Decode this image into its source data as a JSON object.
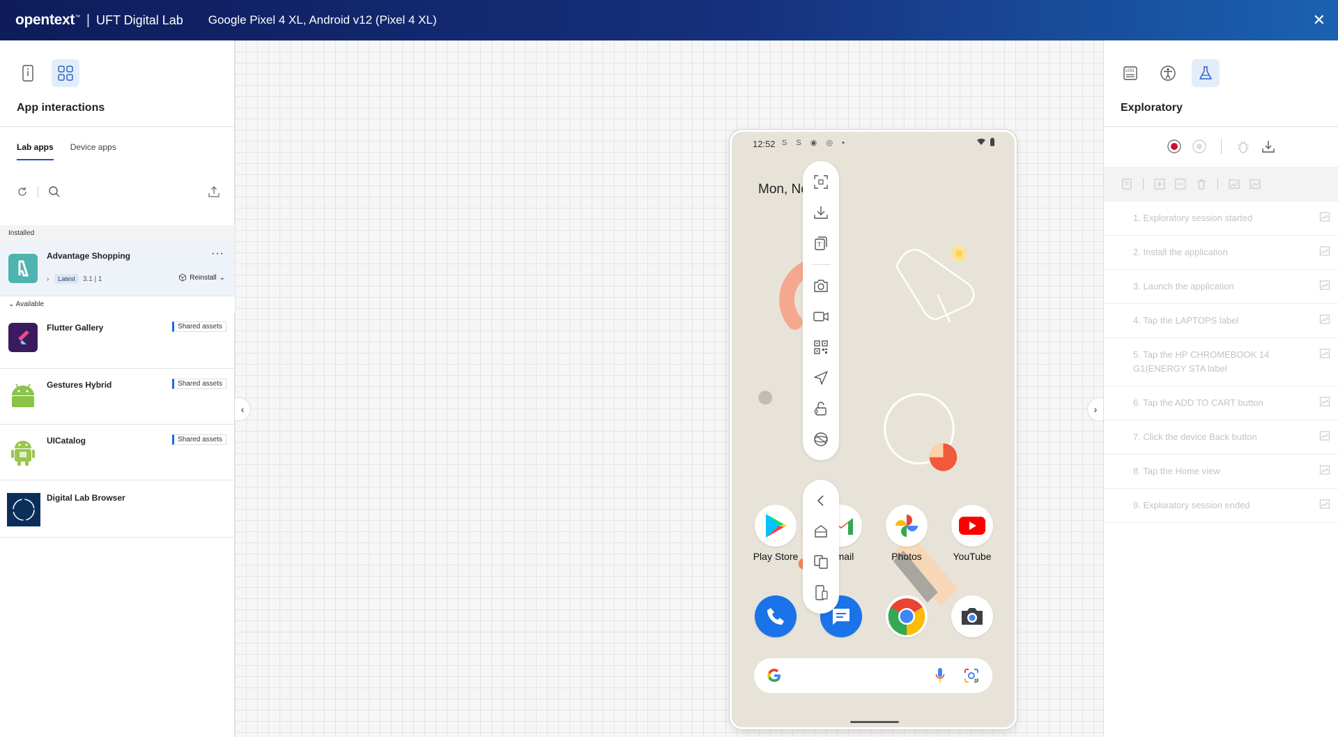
{
  "header": {
    "brand": "opentext",
    "brand_tm": "™",
    "product": "UFT Digital Lab",
    "device": "Google Pixel 4 XL, Android v12 (Pixel 4 XL)",
    "close": "✕"
  },
  "left_panel": {
    "title": "App interactions",
    "tabs": [
      "Lab apps",
      "Device apps"
    ],
    "installed_label": "Installed",
    "available_label": "Available",
    "installed_app": {
      "name": "Advantage Shopping",
      "version_tag": "Latest",
      "version": "3.1 | 1",
      "action": "Reinstall",
      "more": "···"
    },
    "available_apps": [
      {
        "name": "Flutter Gallery",
        "badge": "Shared assets"
      },
      {
        "name": "Gestures Hybrid",
        "badge": "Shared assets"
      },
      {
        "name": "UICatalog",
        "badge": "Shared assets"
      },
      {
        "name": "Digital Lab Browser",
        "badge": ""
      }
    ]
  },
  "phone": {
    "time": "12:52",
    "status_icons": "S S ◉ ◎ •",
    "date": "Mon, Nov 8",
    "apps_row1": [
      "Play Store",
      "Gmail",
      "Photos",
      "YouTube"
    ]
  },
  "right_panel": {
    "title": "Exploratory",
    "steps": [
      "1.  Exploratory session started",
      "2.  Install the application",
      "3.  Launch the application",
      "4.  Tap the LAPTOPS label",
      "5.  Tap the HP CHROMEBOOK 14 G1(ENERGY STA label",
      "6.  Tap the ADD TO CART button",
      "7.  Click the device Back button",
      "8.  Tap the Home view",
      "9.  Exploratory session ended"
    ]
  },
  "colors": {
    "header_start": "#0e1c5a",
    "header_end": "#1a62b0",
    "accent": "#1a4fc6",
    "record_red": "#c8102e",
    "phone_wallpaper": "#e8e3d9"
  }
}
